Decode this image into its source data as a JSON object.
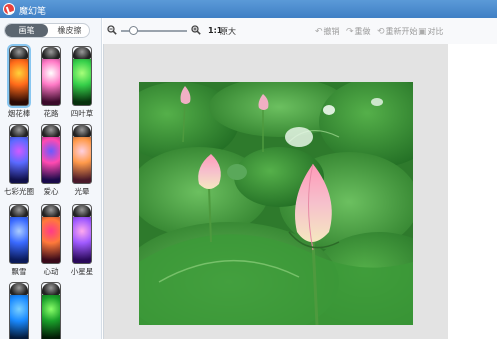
{
  "window": {
    "title": "魔幻笔"
  },
  "sidebar": {
    "tabs": [
      {
        "label": "画笔"
      },
      {
        "label": "橡皮擦"
      }
    ],
    "brushes": [
      {
        "label": "烟花棒",
        "colors": [
          "#2a0a05",
          "#ff6a1a",
          "#ffd23a",
          "#6a1a06"
        ],
        "selected": true
      },
      {
        "label": "花路",
        "colors": [
          "#3a0a2a",
          "#ff7ac6",
          "#ffffff",
          "#a02a7a"
        ],
        "selected": false
      },
      {
        "label": "四叶草",
        "colors": [
          "#06300c",
          "#36d04a",
          "#a8ff7a",
          "#0a4a14"
        ],
        "selected": false
      },
      {
        "label": "七彩光圈",
        "colors": [
          "#10104a",
          "#5a6aff",
          "#d05aff",
          "#1a1a7a"
        ],
        "selected": false
      },
      {
        "label": "爱心",
        "colors": [
          "#1a0a4a",
          "#ff4ab0",
          "#6a5aff",
          "#2a0a6a"
        ],
        "selected": false
      },
      {
        "label": "光晕",
        "colors": [
          "#4a1a2a",
          "#ff9a4a",
          "#ffd0e0",
          "#7a2a4a"
        ],
        "selected": false
      },
      {
        "label": "飘雪",
        "colors": [
          "#0a1a5a",
          "#3a6aff",
          "#aaccff",
          "#0a2a8a"
        ],
        "selected": false
      },
      {
        "label": "心动",
        "colors": [
          "#3a0a1a",
          "#ff7a3a",
          "#ff3a8a",
          "#5a0a2a"
        ],
        "selected": false
      },
      {
        "label": "小星星",
        "colors": [
          "#2a0a5a",
          "#a05aff",
          "#ffaaee",
          "#4a1a8a"
        ],
        "selected": false
      },
      {
        "label": "",
        "colors": [
          "#041a3a",
          "#1a8aff",
          "#7ad0ff",
          "#062a6a"
        ],
        "selected": false
      },
      {
        "label": "",
        "colors": [
          "#021a06",
          "#1aa02a",
          "#8aff6a",
          "#04300a"
        ],
        "selected": false
      }
    ]
  },
  "toolbar": {
    "ratio": "1:1",
    "ratio_label": "原大",
    "undo": "撤销",
    "redo": "重做",
    "restart": "重新开始",
    "compare": "对比"
  },
  "canvas": {
    "background": "#e3e3e3",
    "photo_subject": "lotus-flowers-among-leaves"
  },
  "colors": {
    "titlebar": "#4a8ad0",
    "tab_active": "#5c6670",
    "selection": "#88c6f0"
  }
}
